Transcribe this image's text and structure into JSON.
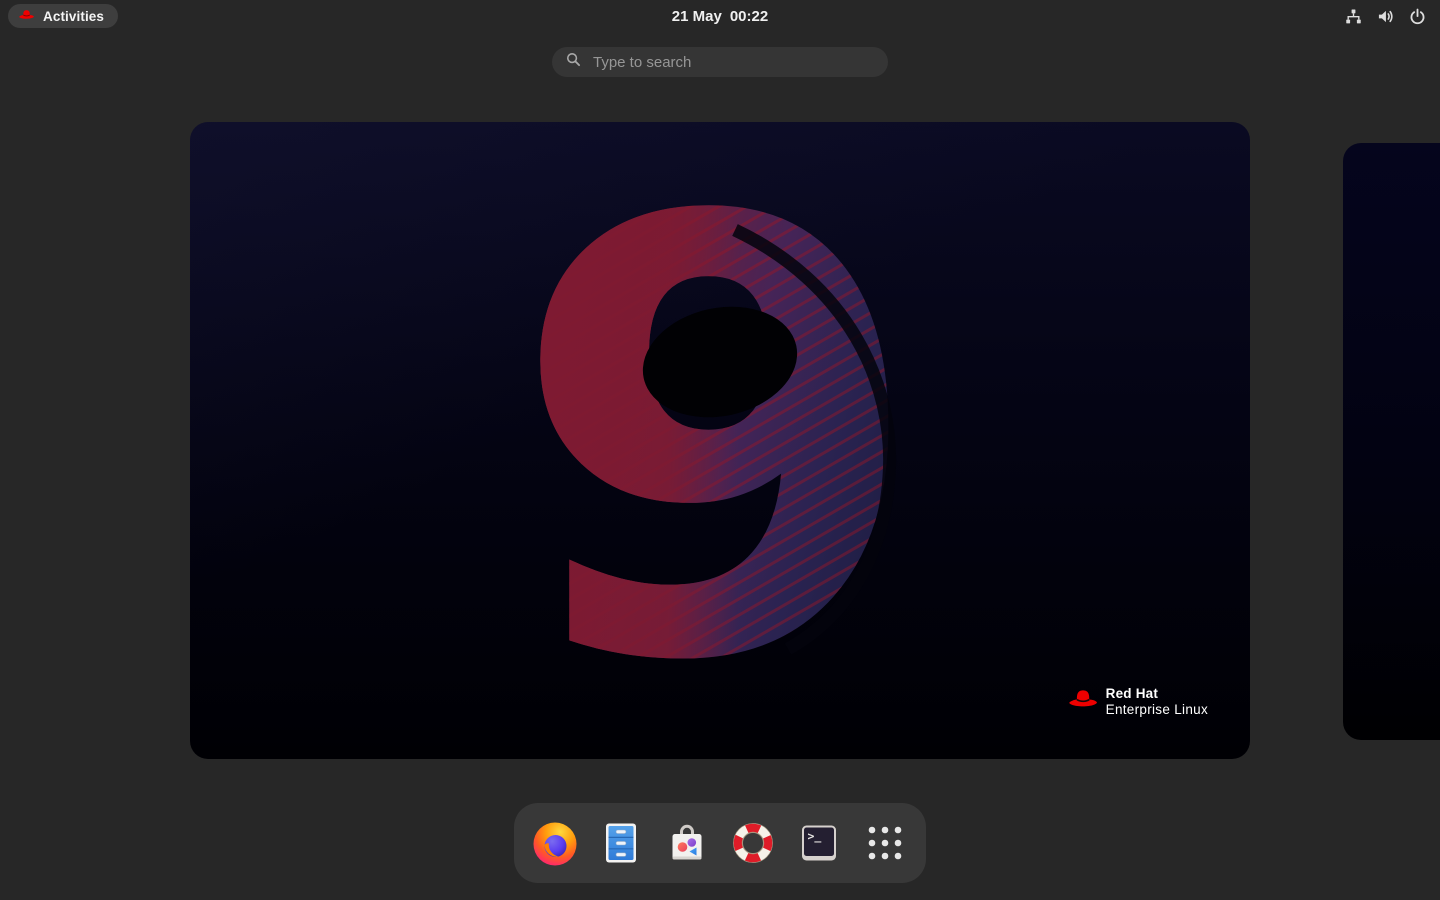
{
  "top_bar": {
    "activities": {
      "label": "Activities"
    },
    "clock": {
      "date": "21 May",
      "time": "00:22"
    },
    "tray": {
      "icons": [
        "network-wired-icon",
        "volume-icon",
        "power-icon"
      ]
    }
  },
  "search": {
    "placeholder": "Type to search"
  },
  "overview": {
    "wallpaper": {
      "numeral": "9",
      "brand_line1": "Red Hat",
      "brand_line2": "Enterprise Linux"
    }
  },
  "dock": {
    "items": [
      {
        "icon": "firefox-icon"
      },
      {
        "icon": "files-icon"
      },
      {
        "icon": "software-icon"
      },
      {
        "icon": "help-icon"
      },
      {
        "icon": "terminal-icon"
      },
      {
        "icon": "app-grid-icon"
      }
    ]
  },
  "colors": {
    "desktop_bg": "#272727",
    "activities_pill_bg": "#3e3e3e",
    "search_bg": "#353535",
    "dock_bg": "#383838",
    "red_hat_red": "#ee0000",
    "wallpaper_navy_top": "#0a0a22",
    "wallpaper_black_bottom": "#000004",
    "numeral_red": "#8a1b33",
    "numeral_blue": "#1b1c40",
    "text_light": "#f2f2f2"
  }
}
